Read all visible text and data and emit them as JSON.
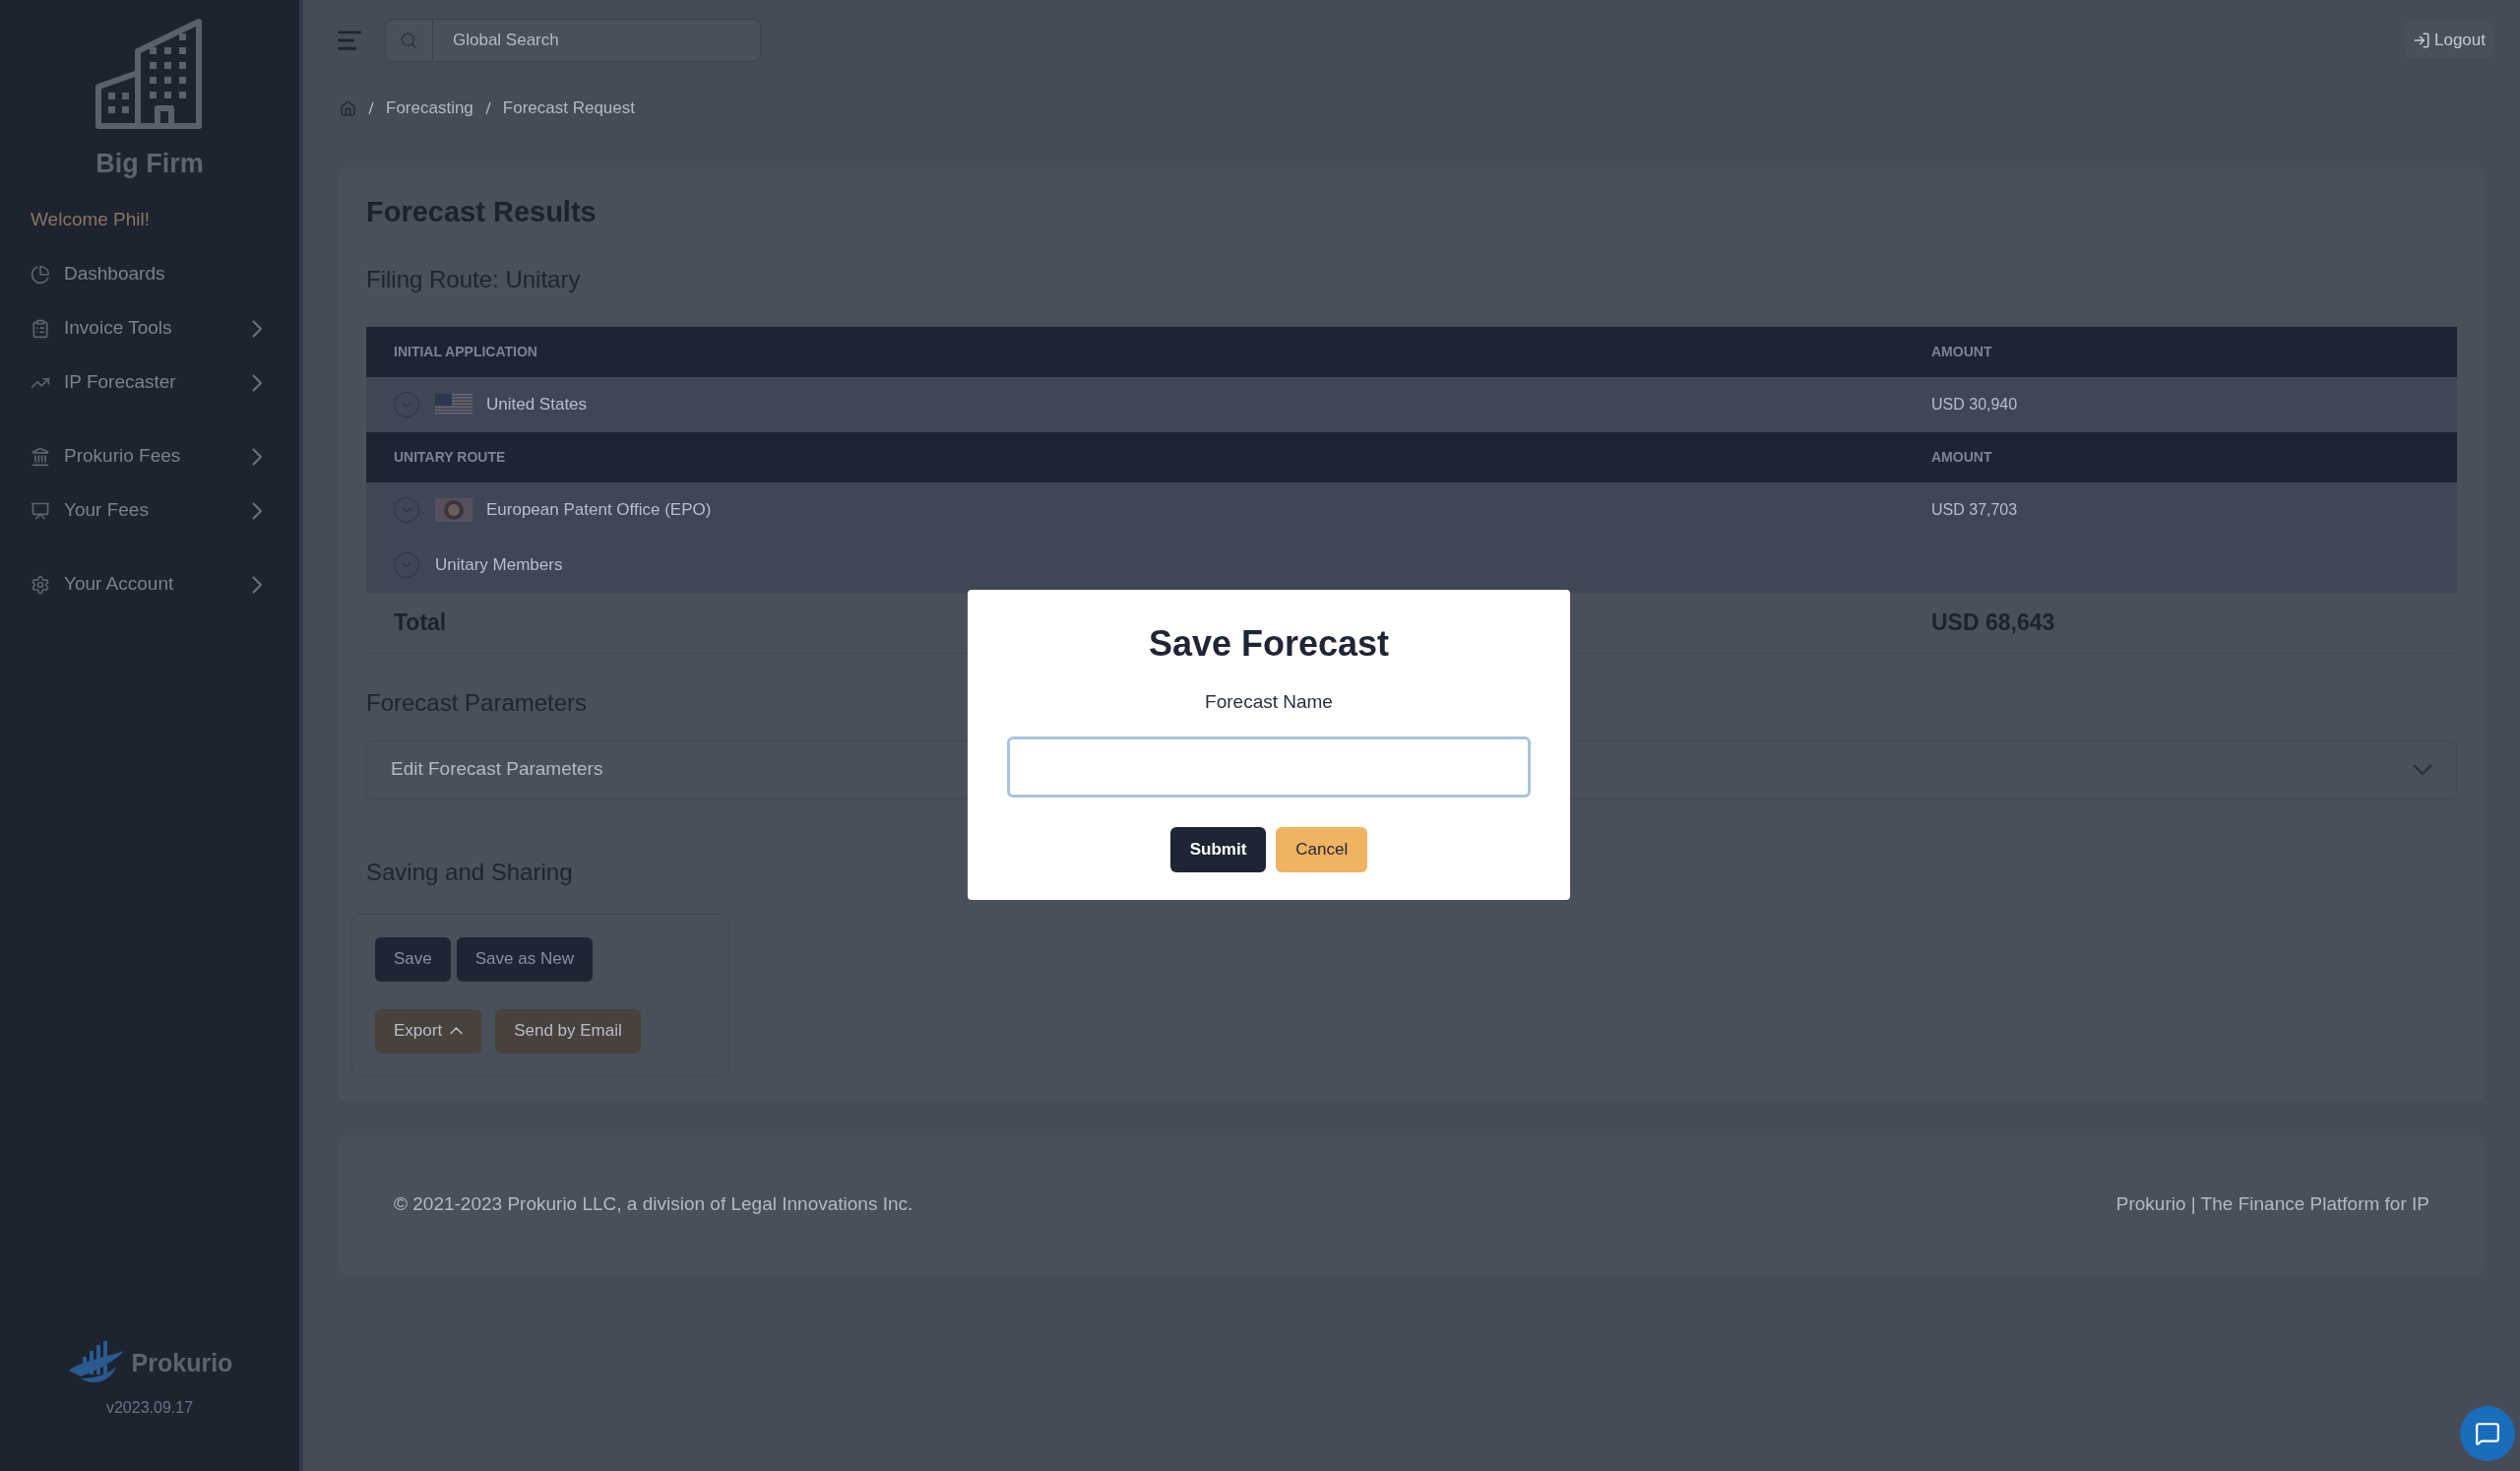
{
  "sidebar": {
    "brand": "Big Firm",
    "welcome": "Welcome Phil!",
    "groups": [
      {
        "items": [
          {
            "label": "Dashboards",
            "kind": "pie",
            "has_submenu": false
          },
          {
            "label": "Invoice Tools",
            "kind": "clipboard",
            "has_submenu": true
          },
          {
            "label": "IP Forecaster",
            "kind": "trend",
            "has_submenu": true
          }
        ]
      },
      {
        "items": [
          {
            "label": "Prokurio Fees",
            "kind": "bank",
            "has_submenu": true
          },
          {
            "label": "Your Fees",
            "kind": "person",
            "has_submenu": true
          }
        ]
      },
      {
        "items": [
          {
            "label": "Your Account",
            "kind": "gear",
            "has_submenu": true
          }
        ]
      }
    ],
    "footer_brand": "Prokurio",
    "version": "v2023.09.17"
  },
  "topbar": {
    "search": {
      "placeholder": "Global Search"
    },
    "logout": "Logout"
  },
  "breadcrumb": [
    "Forecasting",
    "Forecast Request"
  ],
  "results": {
    "title": "Forecast Results",
    "route_title": "Filing Route: Unitary",
    "sections": [
      {
        "columns": [
          "INITIAL APPLICATION",
          "AMOUNT"
        ],
        "rows": [
          {
            "kind": "us",
            "label": "United States",
            "amount": "USD 30,940"
          }
        ]
      },
      {
        "columns": [
          "UNITARY ROUTE",
          "AMOUNT"
        ],
        "rows": [
          {
            "kind": "epo",
            "label": "European Patent Office (EPO)",
            "amount": "USD 37,703"
          },
          {
            "kind": "plain",
            "label": "Unitary Members"
          }
        ]
      }
    ],
    "total": {
      "label": "Total",
      "amount": "USD 68,643"
    }
  },
  "parameters": {
    "title": "Forecast Parameters",
    "accordion": "Edit Forecast Parameters",
    "expanded": false
  },
  "saving": {
    "title": "Saving and Sharing",
    "button_rows": [
      [
        {
          "label": "Save",
          "kind": "primary"
        },
        {
          "label": "Save as New",
          "kind": "primary"
        }
      ],
      [
        {
          "label": "Export",
          "kind": "secondary",
          "caret": true
        },
        {
          "label": "Send by Email",
          "kind": "secondary",
          "caret": false
        }
      ]
    ]
  },
  "footer": {
    "copyright": "© 2021-2023 Prokurio LLC, a division of Legal Innovations Inc.",
    "tagline": "Prokurio | The Finance Platform for IP"
  },
  "modal": {
    "title": "Save Forecast",
    "field_label": "Forecast Name",
    "buttons": [
      {
        "label": "Submit",
        "kind": "primary"
      },
      {
        "label": "Cancel",
        "kind": "secondary"
      }
    ]
  }
}
